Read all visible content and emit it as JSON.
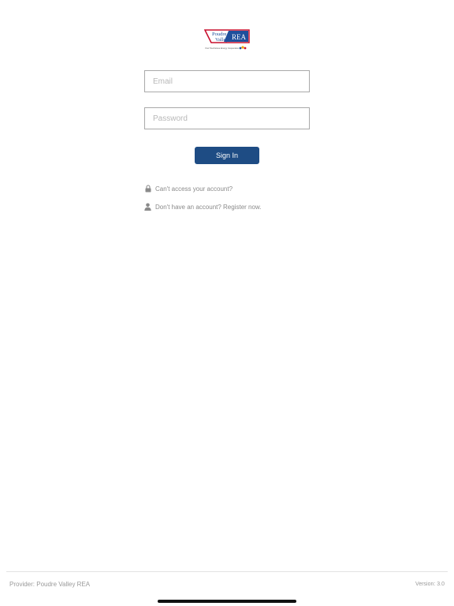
{
  "logo": {
    "name_line1": "Poudre",
    "name_line2": "Valley",
    "monogram": "REA",
    "tagline": "Your Touchstone Energy Cooperative"
  },
  "form": {
    "email_placeholder": "Email",
    "password_placeholder": "Password",
    "signin_label": "Sign In"
  },
  "links": {
    "access_label": "Can't access your account?",
    "register_label": "Don't have an account? Register now.",
    "access_icon": "lock-icon",
    "register_icon": "person-icon"
  },
  "footer": {
    "provider_text": "Provider: Poudre Valley REA",
    "version_text": "Version: 3.0"
  },
  "colors": {
    "primary": "#1e4c84",
    "logo_red": "#c8102e",
    "logo_blue": "#1f4f9c",
    "link_text": "#8a8a8a"
  }
}
